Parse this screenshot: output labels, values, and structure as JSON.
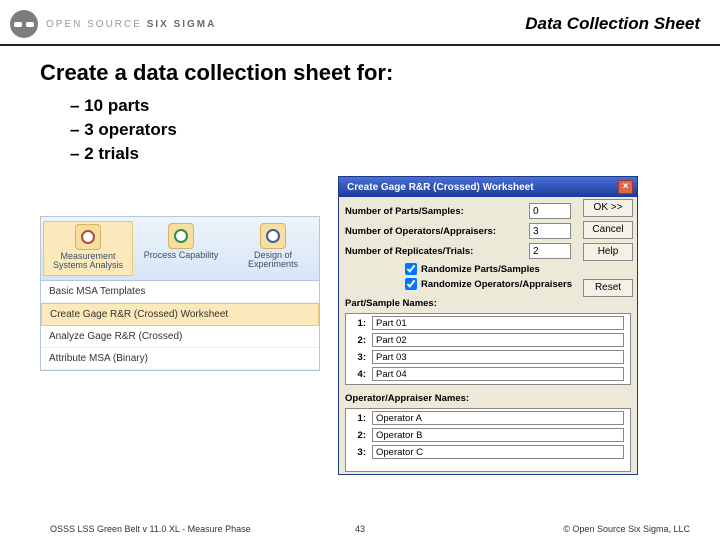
{
  "header": {
    "brand_a": "OPEN SOURCE",
    "brand_b": "SIX SIGMA",
    "page_title": "Data Collection Sheet"
  },
  "headline": "Create a data collection sheet for:",
  "bullets": [
    "10 parts",
    "3 operators",
    "2 trials"
  ],
  "ribbon": {
    "items": [
      {
        "label": "Measurement Systems Analysis"
      },
      {
        "label": "Process Capability"
      },
      {
        "label": "Design of Experiments"
      }
    ],
    "menu": [
      "Basic MSA Templates",
      "Create Gage R&R (Crossed) Worksheet",
      "Analyze Gage R&R (Crossed)",
      "Attribute MSA (Binary)"
    ]
  },
  "dialog": {
    "title": "Create Gage R&R (Crossed) Worksheet",
    "fields": {
      "parts_label": "Number of Parts/Samples:",
      "parts_value": "0",
      "ops_label": "Number of Operators/Appraisers:",
      "ops_value": "3",
      "reps_label": "Number of Replicates/Trials:",
      "reps_value": "2"
    },
    "buttons": {
      "ok": "OK >>",
      "cancel": "Cancel",
      "help": "Help",
      "reset": "Reset"
    },
    "checks": {
      "rand_parts": "Randomize Parts/Samples",
      "rand_ops": "Randomize Operators/Appraisers"
    },
    "part_section": "Part/Sample Names:",
    "parts": [
      "Part 01",
      "Part 02",
      "Part 03",
      "Part 04"
    ],
    "op_section": "Operator/Appraiser Names:",
    "ops": [
      "Operator A",
      "Operator B",
      "Operator C"
    ]
  },
  "footer": {
    "left": "OSSS LSS Green Belt v 11.0 XL - Measure Phase",
    "page": "43",
    "right": "© Open Source Six Sigma, LLC"
  }
}
